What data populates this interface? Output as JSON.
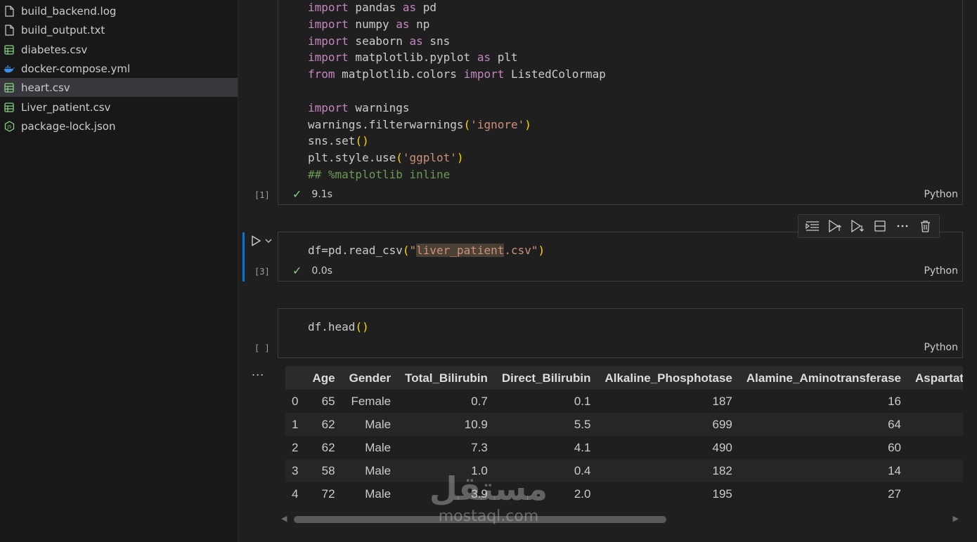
{
  "explorer": {
    "files": [
      {
        "name": "build_backend.log",
        "icon": "file-icon"
      },
      {
        "name": "build_output.txt",
        "icon": "file-icon"
      },
      {
        "name": "diabetes.csv",
        "icon": "csv-icon"
      },
      {
        "name": "docker-compose.yml",
        "icon": "docker-icon"
      },
      {
        "name": "heart.csv",
        "icon": "csv-icon",
        "selected": true
      },
      {
        "name": "Liver_patient.csv",
        "icon": "csv-icon"
      },
      {
        "name": "package-lock.json",
        "icon": "json-icon"
      }
    ]
  },
  "cells": [
    {
      "exec_count": "[1]",
      "status_time": "9.1s",
      "language": "Python",
      "code_lines": [
        "import pandas as pd",
        "import numpy as np",
        "import seaborn as sns",
        "import matplotlib.pyplot as plt",
        "from matplotlib.colors import ListedColormap",
        "",
        "import warnings",
        "warnings.filterwarnings('ignore')",
        "sns.set()",
        "plt.style.use('ggplot')",
        "## %matplotlib inline"
      ]
    },
    {
      "exec_count": "[3]",
      "status_time": "0.0s",
      "language": "Python",
      "code_lines": [
        "df=pd.read_csv(\"liver_patient.csv\")"
      ]
    },
    {
      "exec_count": "[ ]",
      "language": "Python",
      "code_lines": [
        "df.head()"
      ]
    }
  ],
  "toolbar": {
    "buttons": [
      "run-by-line",
      "execute-above",
      "execute-below",
      "split-cell",
      "more",
      "delete"
    ]
  },
  "output": {
    "more_label": "...",
    "columns": [
      "",
      "Age",
      "Gender",
      "Total_Bilirubin",
      "Direct_Bilirubin",
      "Alkaline_Phosphotase",
      "Alamine_Aminotransferase",
      "Aspartat"
    ],
    "rows": [
      [
        "0",
        "65",
        "Female",
        "0.7",
        "0.1",
        "187",
        "16",
        ""
      ],
      [
        "1",
        "62",
        "Male",
        "10.9",
        "5.5",
        "699",
        "64",
        ""
      ],
      [
        "2",
        "62",
        "Male",
        "7.3",
        "4.1",
        "490",
        "60",
        ""
      ],
      [
        "3",
        "58",
        "Male",
        "1.0",
        "0.4",
        "182",
        "14",
        ""
      ],
      [
        "4",
        "72",
        "Male",
        "3.9",
        "2.0",
        "195",
        "27",
        ""
      ]
    ]
  },
  "watermark": {
    "logo": "مستقل",
    "site": "mostaql.com"
  },
  "colors": {
    "accent": "#0078d4",
    "success": "#89d185",
    "keyword": "#c586c0",
    "string": "#ce9178",
    "bracket": "#ffd700",
    "comment": "#6a9955"
  }
}
